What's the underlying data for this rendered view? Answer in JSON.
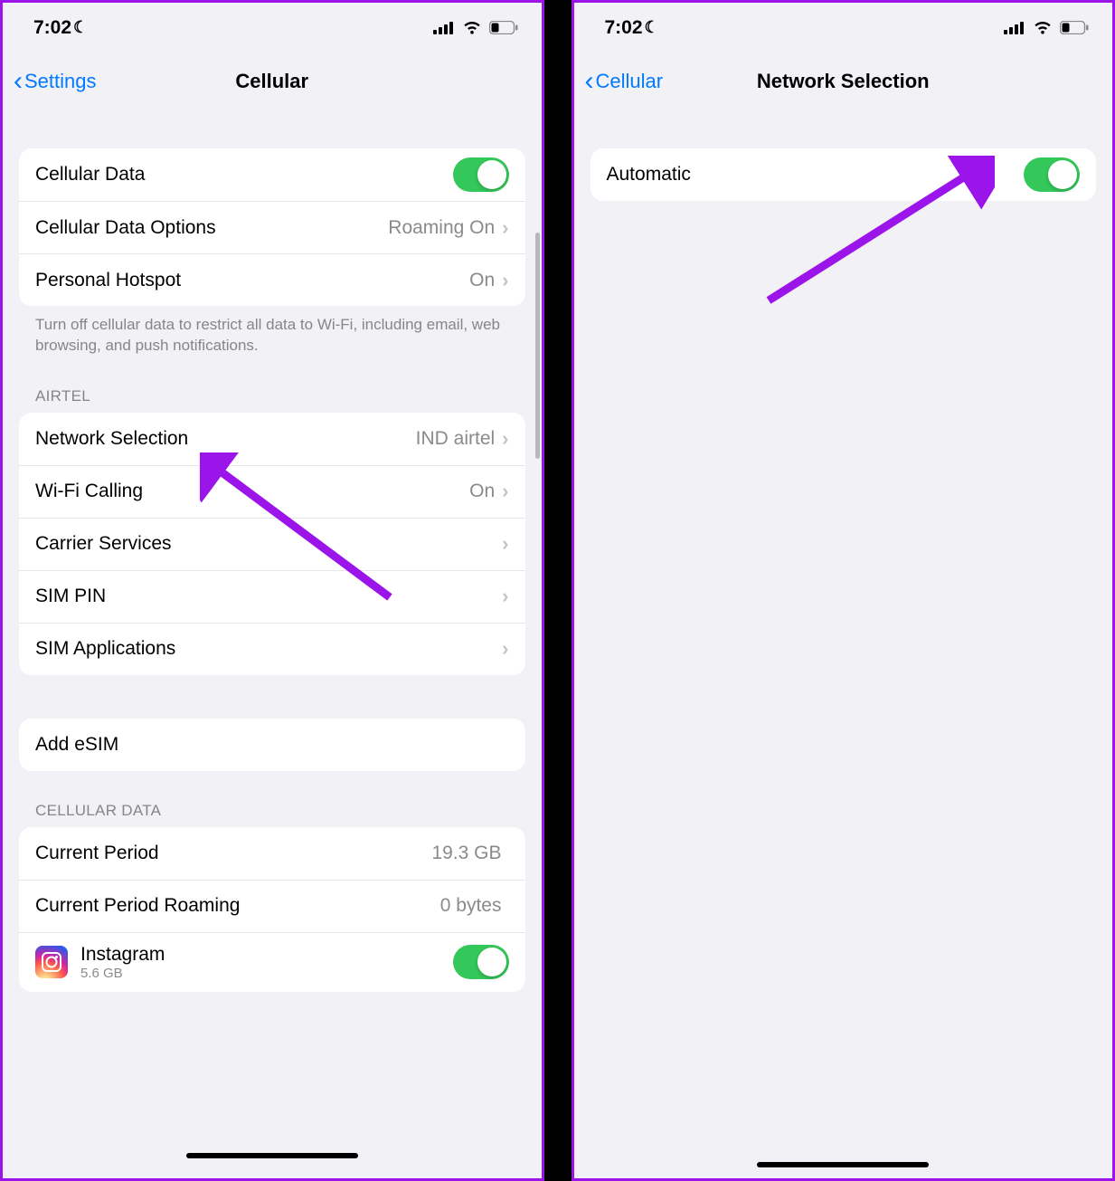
{
  "left": {
    "status_time": "7:02",
    "back_label": "Settings",
    "title": "Cellular",
    "group1": {
      "cellular_data": "Cellular Data",
      "cellular_data_options": "Cellular Data Options",
      "cellular_data_options_value": "Roaming On",
      "personal_hotspot": "Personal Hotspot",
      "personal_hotspot_value": "On"
    },
    "group1_footer": "Turn off cellular data to restrict all data to Wi-Fi, including email, web browsing, and push notifications.",
    "carrier_header": "AIRTEL",
    "group2": {
      "network_selection": "Network Selection",
      "network_selection_value": "IND airtel",
      "wifi_calling": "Wi-Fi Calling",
      "wifi_calling_value": "On",
      "carrier_services": "Carrier Services",
      "sim_pin": "SIM PIN",
      "sim_applications": "SIM Applications"
    },
    "add_esim": "Add eSIM",
    "data_header": "CELLULAR DATA",
    "group3": {
      "current_period": "Current Period",
      "current_period_value": "19.3 GB",
      "current_period_roaming": "Current Period Roaming",
      "current_period_roaming_value": "0 bytes",
      "instagram": "Instagram",
      "instagram_sub": "5.6 GB"
    }
  },
  "right": {
    "status_time": "7:02",
    "back_label": "Cellular",
    "title": "Network Selection",
    "automatic": "Automatic"
  },
  "colors": {
    "accent": "#007aff",
    "toggle_on": "#34c759",
    "annotation_arrow": "#9b15ea"
  }
}
